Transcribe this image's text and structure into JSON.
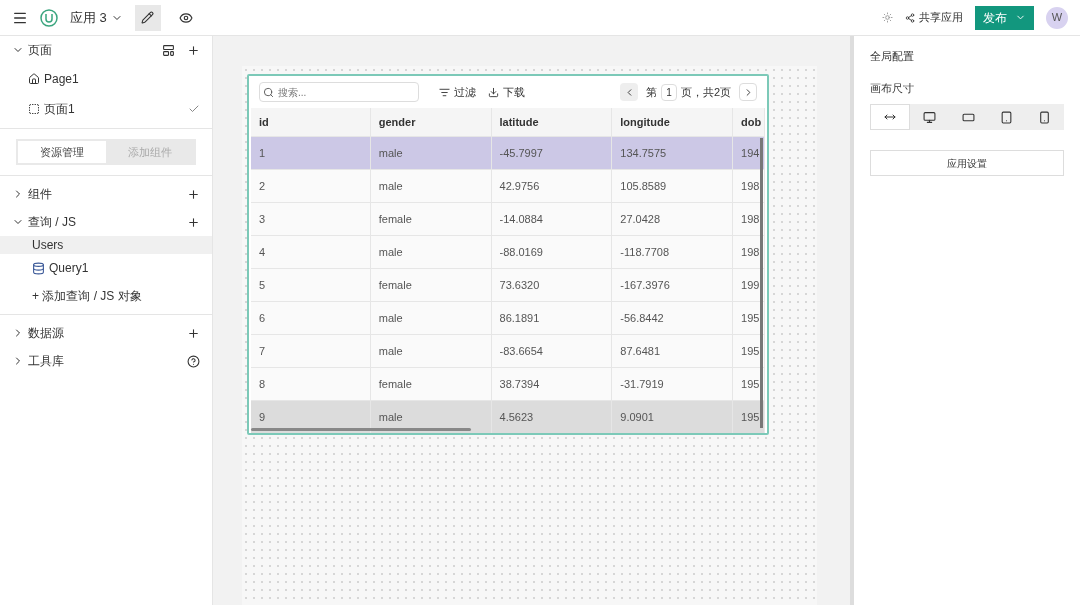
{
  "topbar": {
    "app_name": "应用 3",
    "edit_mode": true,
    "share": "共享应用",
    "publish": "发布",
    "avatar": "W"
  },
  "sidebar": {
    "pages_title": "页面",
    "pages": [
      {
        "label": "Page1",
        "kind": "home",
        "checked": false
      },
      {
        "label": "页面1",
        "kind": "page",
        "checked": true
      }
    ],
    "tabs": [
      {
        "label": "资源管理",
        "selected": true
      },
      {
        "label": "添加组件",
        "selected": false
      }
    ],
    "sections": [
      {
        "label": "组件",
        "expanded": false,
        "kind": "addable"
      },
      {
        "label": "查询 / JS",
        "expanded": true,
        "kind": "addable",
        "group": "Users",
        "items": [
          "Query1"
        ],
        "add": "+ 添加查询 / JS 对象"
      },
      {
        "label": "数据源",
        "expanded": false,
        "kind": "addable"
      },
      {
        "label": "工具库",
        "expanded": false,
        "kind": "help"
      }
    ]
  },
  "table": {
    "search_placeholder": "搜索...",
    "filter": "过滤",
    "download": "下载",
    "pager": {
      "prefix": "第",
      "page": "1",
      "suffix": "页，共2页"
    },
    "columns": [
      "id",
      "gender",
      "latitude",
      "longitude",
      "dob"
    ],
    "rows": [
      {
        "cells": [
          "1",
          "male",
          "-45.7997",
          "134.7575",
          "194"
        ],
        "selected": true,
        "hovered": false
      },
      {
        "cells": [
          "2",
          "male",
          "42.9756",
          "105.8589",
          "198"
        ],
        "selected": false,
        "hovered": false
      },
      {
        "cells": [
          "3",
          "female",
          "-14.0884",
          "27.0428",
          "198"
        ],
        "selected": false,
        "hovered": false
      },
      {
        "cells": [
          "4",
          "male",
          "-88.0169",
          "-118.7708",
          "198"
        ],
        "selected": false,
        "hovered": false
      },
      {
        "cells": [
          "5",
          "female",
          "73.6320",
          "-167.3976",
          "199"
        ],
        "selected": false,
        "hovered": false
      },
      {
        "cells": [
          "6",
          "male",
          "86.1891",
          "-56.8442",
          "195"
        ],
        "selected": false,
        "hovered": false
      },
      {
        "cells": [
          "7",
          "male",
          "-83.6654",
          "87.6481",
          "195"
        ],
        "selected": false,
        "hovered": false
      },
      {
        "cells": [
          "8",
          "female",
          "38.7394",
          "-31.7919",
          "195"
        ],
        "selected": false,
        "hovered": false
      },
      {
        "cells": [
          "9",
          "male",
          "4.5623",
          "9.0901",
          "195"
        ],
        "selected": false,
        "hovered": true
      }
    ]
  },
  "right_panel": {
    "title": "全局配置",
    "canvas_size": "画布尺寸",
    "sizes": [
      {
        "kind": "auto",
        "selected": true
      },
      {
        "kind": "desktop",
        "selected": false
      },
      {
        "kind": "tablet-wide",
        "selected": false
      },
      {
        "kind": "tablet",
        "selected": false
      },
      {
        "kind": "phone",
        "selected": false
      }
    ],
    "settings_button": "应用设置"
  }
}
